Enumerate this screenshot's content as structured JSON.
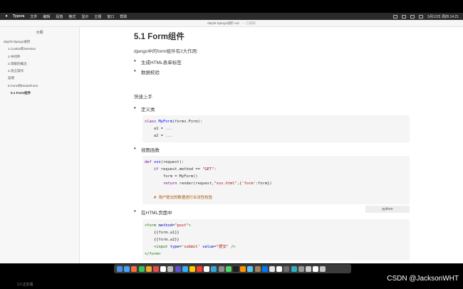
{
  "menubar": {
    "app_name": "Typora",
    "items": [
      "文件",
      "编辑",
      "段落",
      "格式",
      "显示",
      "主题",
      "窗口",
      "帮助"
    ],
    "datetime": "5月12日 周四 14:21"
  },
  "window": {
    "title": "day09 Django进阶.md",
    "edited_label": "— 已编辑"
  },
  "sidebar": {
    "outline_title": "大纲",
    "items": [
      {
        "label": "day09 Django进阶",
        "level": 1
      },
      {
        "label": "1.Cookie和Session",
        "level": 2
      },
      {
        "label": "2.中间件",
        "level": 2
      },
      {
        "label": "3.母版的概念",
        "level": 2
      },
      {
        "label": "4.语言操作",
        "level": 2
      },
      {
        "label": "案例",
        "level": 2
      },
      {
        "label": "5.Form和ModelForm",
        "level": 2
      },
      {
        "label": "5.1 Form组件",
        "level": 3
      }
    ]
  },
  "doc": {
    "heading": "5.1 Form组件",
    "intro": "django中的form组件有2大作用:",
    "bullets_top": [
      "生成HTML表单标签",
      "数据校验"
    ],
    "quick_start": "快速上手",
    "step1": "定义类",
    "step2": "视图函数",
    "step3": "在HTML页面中",
    "code_lang": "python"
  },
  "dock": {
    "icon_colors": [
      "#4a90e2",
      "#3ea6ff",
      "#ff6b3d",
      "#34c759",
      "#f5a623",
      "#e94c4c",
      "#ffffff",
      "#c0c0c0",
      "#5856d6",
      "#2fb5ff",
      "#ffcc00",
      "#ff3b30",
      "#ffffff",
      "#34aadc",
      "#8e8e93",
      "#4cd964",
      "#1f1f1f",
      "#ff9500",
      "#5ac8fa",
      "#a2845e",
      "#007aff",
      "#e5e5ea",
      "#ffffff",
      "#6d6d72",
      "#30b0c7",
      "#9a9a9a",
      "#d0d0d0",
      "#ffffff",
      "#c7c7cc"
    ]
  },
  "footer": {
    "viewers": "1人正在看",
    "watermark": "CSDN @JacksonWHT"
  }
}
